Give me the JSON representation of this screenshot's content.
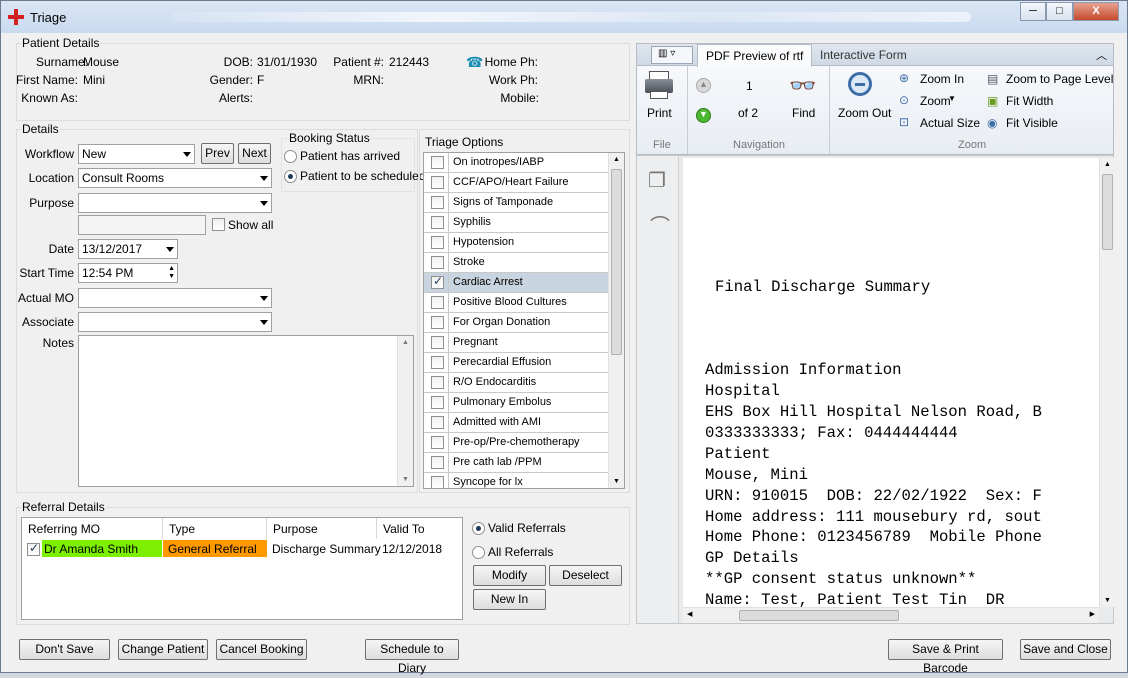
{
  "window": {
    "title": "Triage",
    "min": "─",
    "max": "□",
    "close": "X"
  },
  "patient": {
    "section_title": "Patient Details",
    "surname_label": "Surname:",
    "surname": "Mouse",
    "first_name_label": "First Name:",
    "first_name": "Mini",
    "known_as_label": "Known As:",
    "dob_label": "DOB:",
    "dob": "31/01/1930",
    "gender_label": "Gender:",
    "gender": "F",
    "alerts_label": "Alerts:",
    "patient_no_label": "Patient #:",
    "patient_no": "212443",
    "mrn_label": "MRN:",
    "home_ph_label": "Home Ph:",
    "work_ph_label": "Work Ph:",
    "mobile_label": "Mobile:"
  },
  "details": {
    "section_title": "Details",
    "workflow_label": "Workflow",
    "workflow": "New",
    "prev": "Prev",
    "next": "Next",
    "location_label": "Location",
    "location": "Consult Rooms",
    "purpose_label": "Purpose",
    "purpose": "",
    "show_all": "Show all",
    "date_label": "Date",
    "date": "13/12/2017",
    "start_time_label": "Start Time",
    "start_time": "12:54 PM",
    "actual_mo_label": "Actual MO",
    "associate_label": "Associate",
    "notes_label": "Notes"
  },
  "booking": {
    "title": "Booking Status",
    "options": [
      "Patient has arrived",
      "Patient to be scheduled"
    ],
    "selected": 1
  },
  "triage": {
    "title": "Triage Options",
    "items": [
      {
        "label": "On inotropes/IABP",
        "checked": false
      },
      {
        "label": "CCF/APO/Heart Failure",
        "checked": false
      },
      {
        "label": "Signs of Tamponade",
        "checked": false
      },
      {
        "label": "Syphilis",
        "checked": false
      },
      {
        "label": "Hypotension",
        "checked": false
      },
      {
        "label": "Stroke",
        "checked": false
      },
      {
        "label": "Cardiac Arrest",
        "checked": true
      },
      {
        "label": "Positive Blood Cultures",
        "checked": false
      },
      {
        "label": "For Organ Donation",
        "checked": false
      },
      {
        "label": "Pregnant",
        "checked": false
      },
      {
        "label": "Perecardial Effusion",
        "checked": false
      },
      {
        "label": "R/O Endocarditis",
        "checked": false
      },
      {
        "label": "Pulmonary Embolus",
        "checked": false
      },
      {
        "label": "Admitted with AMI",
        "checked": false
      },
      {
        "label": "Pre-op/Pre-chemotherapy",
        "checked": false
      },
      {
        "label": "Pre cath lab /PPM",
        "checked": false
      },
      {
        "label": "Syncope for lx",
        "checked": false
      }
    ]
  },
  "referral": {
    "section_title": "Referral Details",
    "columns": [
      "Referring MO",
      "Type",
      "Purpose",
      "Valid To"
    ],
    "rows": [
      {
        "mo": "Dr Amanda Smith",
        "type": "General Referral",
        "purpose": "Discharge Summary",
        "valid_to": "12/12/2018",
        "checked": true
      }
    ],
    "valid_referrals": "Valid Referrals",
    "all_referrals": "All Referrals",
    "modify": "Modify",
    "deselect": "Deselect",
    "new_in": "New In",
    "colors": {
      "mo_bg": "#7cf000",
      "type_bg": "#ff9900"
    }
  },
  "ribbon": {
    "tabs": [
      "PDF Preview of rtf",
      "Interactive Form"
    ],
    "print": "Print",
    "page": "1",
    "of": "of 2",
    "find": "Find",
    "zoom_out": "Zoom Out",
    "zoom_in": "Zoom In",
    "zoom": "Zoom",
    "actual_size": "Actual Size",
    "zoom_page": "Zoom to Page Level",
    "fit_width": "Fit Width",
    "fit_visible": "Fit Visible",
    "group_file": "File",
    "group_nav": "Navigation",
    "group_zoom": "Zoom"
  },
  "document": {
    "lines": [
      "Final Discharge Summary",
      "Admission Information",
      "Hospital",
      "EHS Box Hill Hospital Nelson Road, B",
      "0333333333; Fax: 0444444444",
      "Patient",
      "Mouse, Mini",
      "URN: 910015  DOB: 22/02/1922  Sex: F",
      "Home address: 111 mousebury rd, sout",
      "Home Phone: 0123456789  Mobile Phone",
      "GP Details",
      "**GP consent status unknown**",
      "Name: Test, Patient Test Tin  DR"
    ]
  },
  "footer": {
    "dont_save": "Don't Save",
    "change_patient": "Change Patient",
    "cancel_booking": "Cancel Booking",
    "schedule": "Schedule to Diary",
    "save_print": "Save & Print Barcode",
    "save_close": "Save and Close"
  }
}
